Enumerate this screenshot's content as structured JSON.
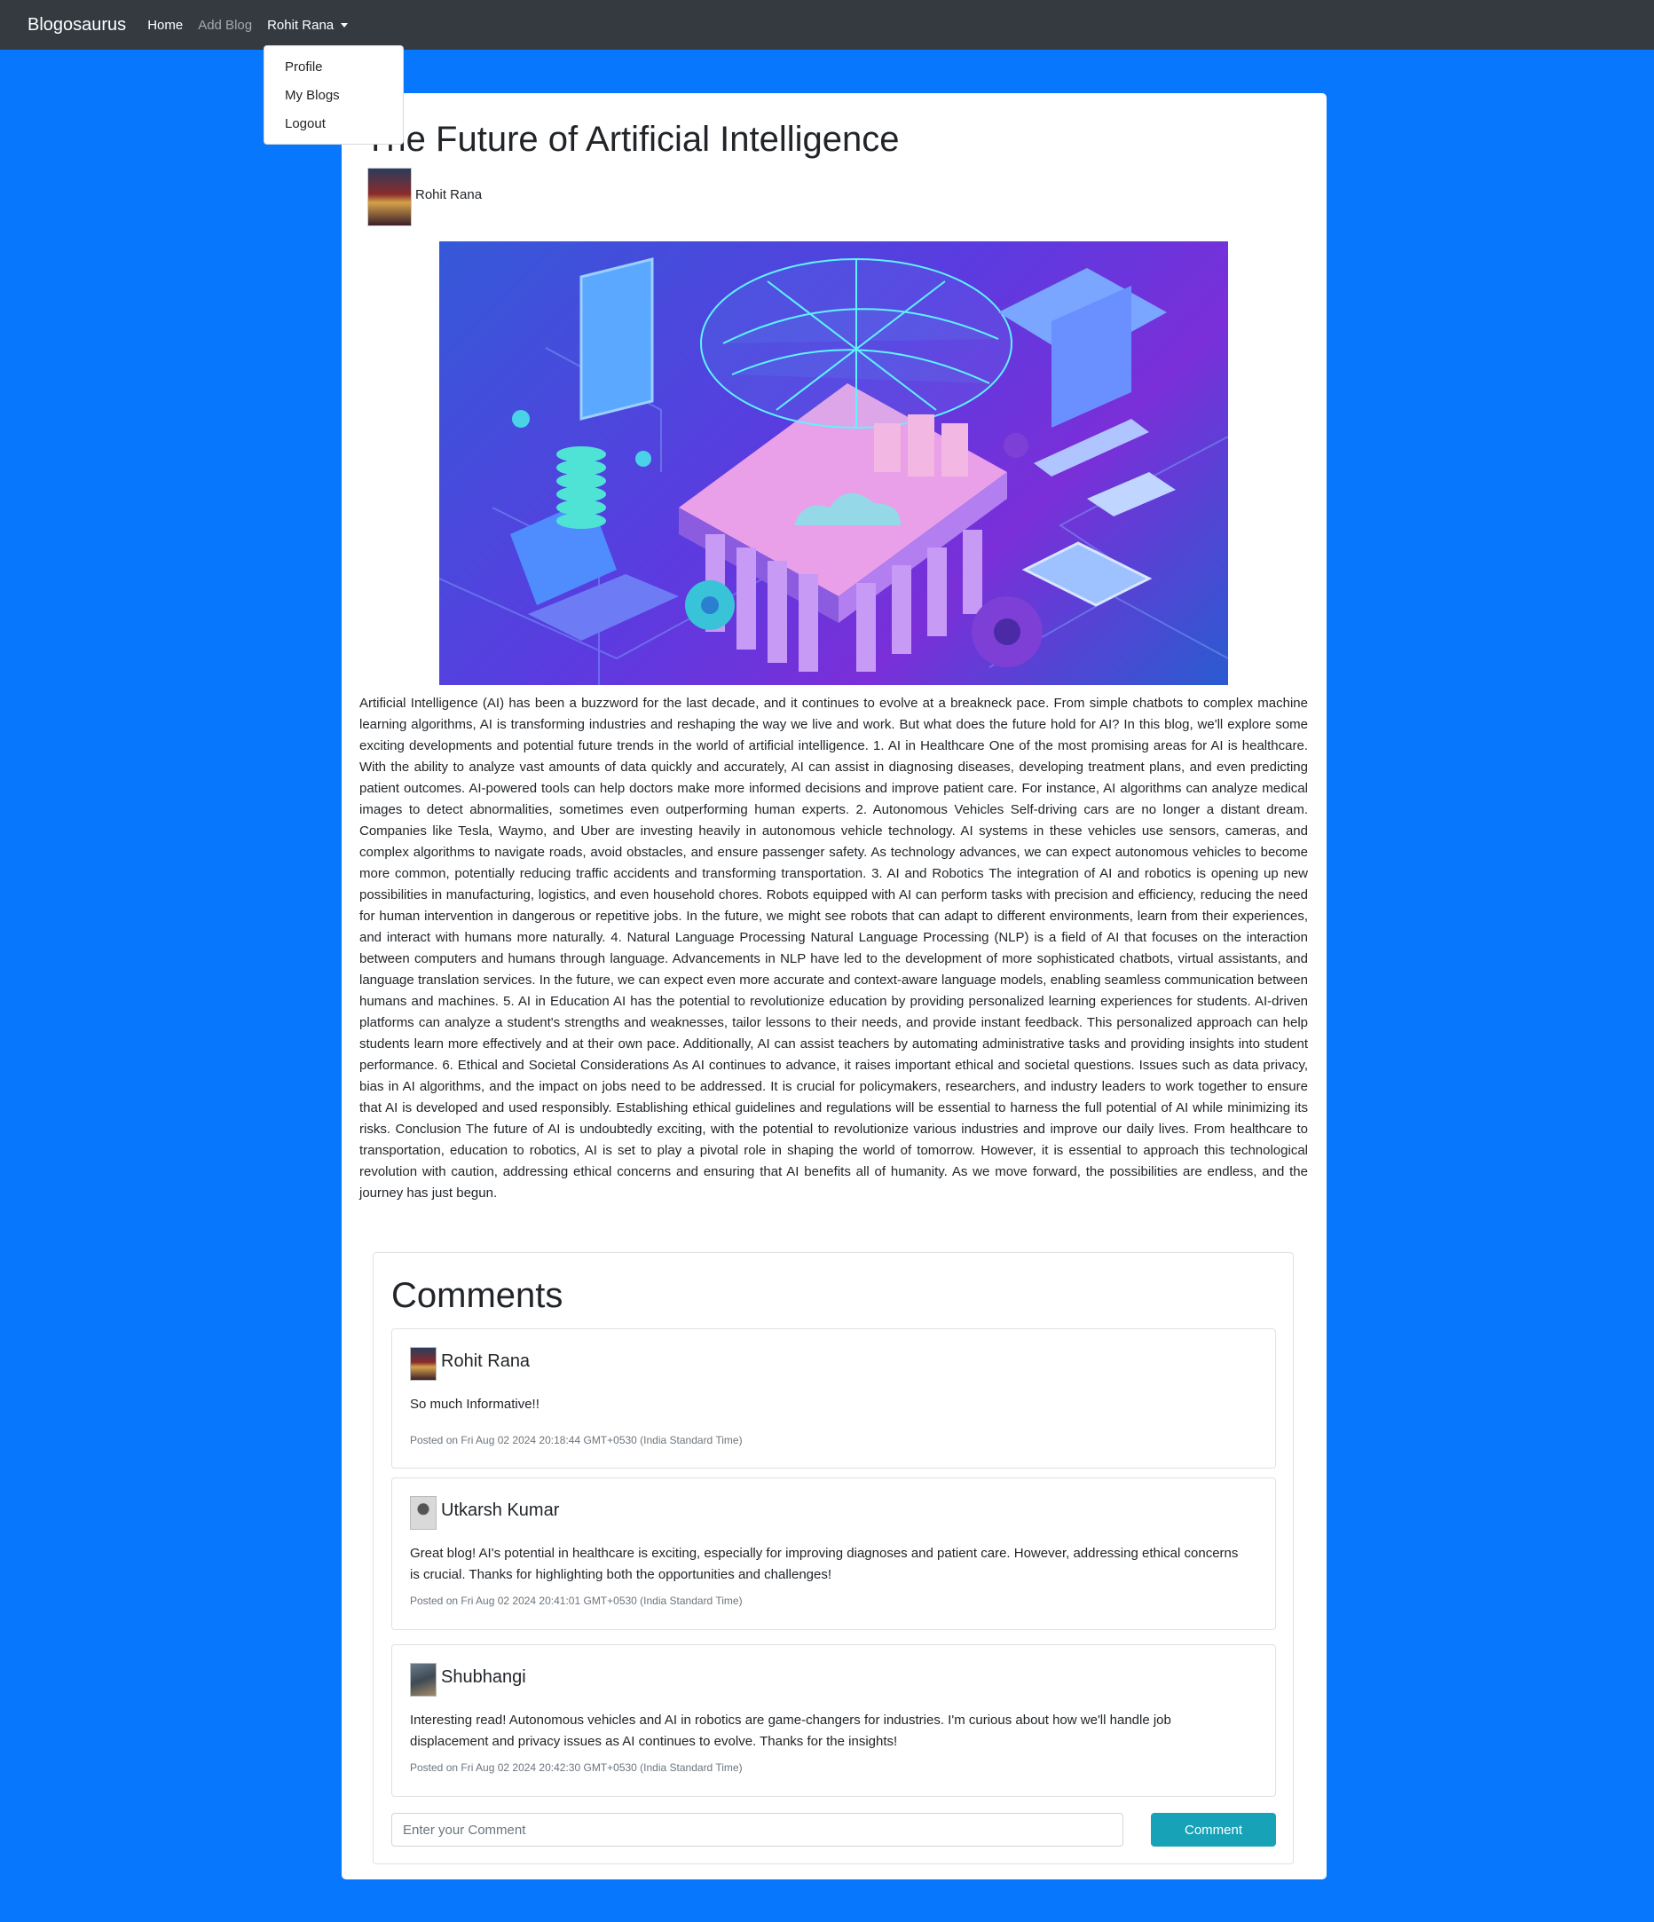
{
  "navbar": {
    "brand": "Blogosaurus",
    "home": "Home",
    "add_blog": "Add Blog",
    "user": "Rohit Rana"
  },
  "dropdown": {
    "items": [
      "Profile",
      "My Blogs",
      "Logout"
    ]
  },
  "post": {
    "title": "The Future of Artificial Intelligence",
    "author": "Rohit Rana",
    "body": "Artificial Intelligence (AI) has been a buzzword for the last decade, and it continues to evolve at a breakneck pace. From simple chatbots to complex machine learning algorithms, AI is transforming industries and reshaping the way we live and work. But what does the future hold for AI? In this blog, we'll explore some exciting developments and potential future trends in the world of artificial intelligence. 1. AI in Healthcare One of the most promising areas for AI is healthcare. With the ability to analyze vast amounts of data quickly and accurately, AI can assist in diagnosing diseases, developing treatment plans, and even predicting patient outcomes. AI-powered tools can help doctors make more informed decisions and improve patient care. For instance, AI algorithms can analyze medical images to detect abnormalities, sometimes even outperforming human experts. 2. Autonomous Vehicles Self-driving cars are no longer a distant dream. Companies like Tesla, Waymo, and Uber are investing heavily in autonomous vehicle technology. AI systems in these vehicles use sensors, cameras, and complex algorithms to navigate roads, avoid obstacles, and ensure passenger safety. As technology advances, we can expect autonomous vehicles to become more common, potentially reducing traffic accidents and transforming transportation. 3. AI and Robotics The integration of AI and robotics is opening up new possibilities in manufacturing, logistics, and even household chores. Robots equipped with AI can perform tasks with precision and efficiency, reducing the need for human intervention in dangerous or repetitive jobs. In the future, we might see robots that can adapt to different environments, learn from their experiences, and interact with humans more naturally. 4. Natural Language Processing Natural Language Processing (NLP) is a field of AI that focuses on the interaction between computers and humans through language. Advancements in NLP have led to the development of more sophisticated chatbots, virtual assistants, and language translation services. In the future, we can expect even more accurate and context-aware language models, enabling seamless communication between humans and machines. 5. AI in Education AI has the potential to revolutionize education by providing personalized learning experiences for students. AI-driven platforms can analyze a student's strengths and weaknesses, tailor lessons to their needs, and provide instant feedback. This personalized approach can help students learn more effectively and at their own pace. Additionally, AI can assist teachers by automating administrative tasks and providing insights into student performance. 6. Ethical and Societal Considerations As AI continues to advance, it raises important ethical and societal questions. Issues such as data privacy, bias in AI algorithms, and the impact on jobs need to be addressed. It is crucial for policymakers, researchers, and industry leaders to work together to ensure that AI is developed and used responsibly. Establishing ethical guidelines and regulations will be essential to harness the full potential of AI while minimizing its risks. Conclusion The future of AI is undoubtedly exciting, with the potential to revolutionize various industries and improve our daily lives. From healthcare to transportation, education to robotics, AI is set to play a pivotal role in shaping the world of tomorrow. However, it is essential to approach this technological revolution with caution, addressing ethical concerns and ensuring that AI benefits all of humanity. As we move forward, the possibilities are endless, and the journey has just begun."
  },
  "comments": {
    "title": "Comments",
    "items": [
      {
        "name": "Rohit Rana",
        "text": "So much Informative!!",
        "date": "Posted on Fri Aug 02 2024 20:18:44 GMT+0530 (India Standard Time)"
      },
      {
        "name": "Utkarsh Kumar",
        "text": "Great blog! AI's potential in healthcare is exciting, especially for improving diagnoses and patient care. However, addressing ethical concerns is crucial. Thanks for highlighting both the opportunities and challenges!",
        "date": "Posted on Fri Aug 02 2024 20:41:01 GMT+0530 (India Standard Time)"
      },
      {
        "name": "Shubhangi",
        "text": "Interesting read! Autonomous vehicles and AI in robotics are game-changers for industries. I'm curious about how we'll handle job displacement and privacy issues as AI continues to evolve. Thanks for the insights!",
        "date": "Posted on Fri Aug 02 2024 20:42:30 GMT+0530 (India Standard Time)"
      }
    ],
    "input_placeholder": "Enter your Comment",
    "submit_label": "Comment"
  },
  "colors": {
    "page_background": "#0777fe",
    "navbar": "#343a40",
    "comment_button": "#17a2b8"
  }
}
